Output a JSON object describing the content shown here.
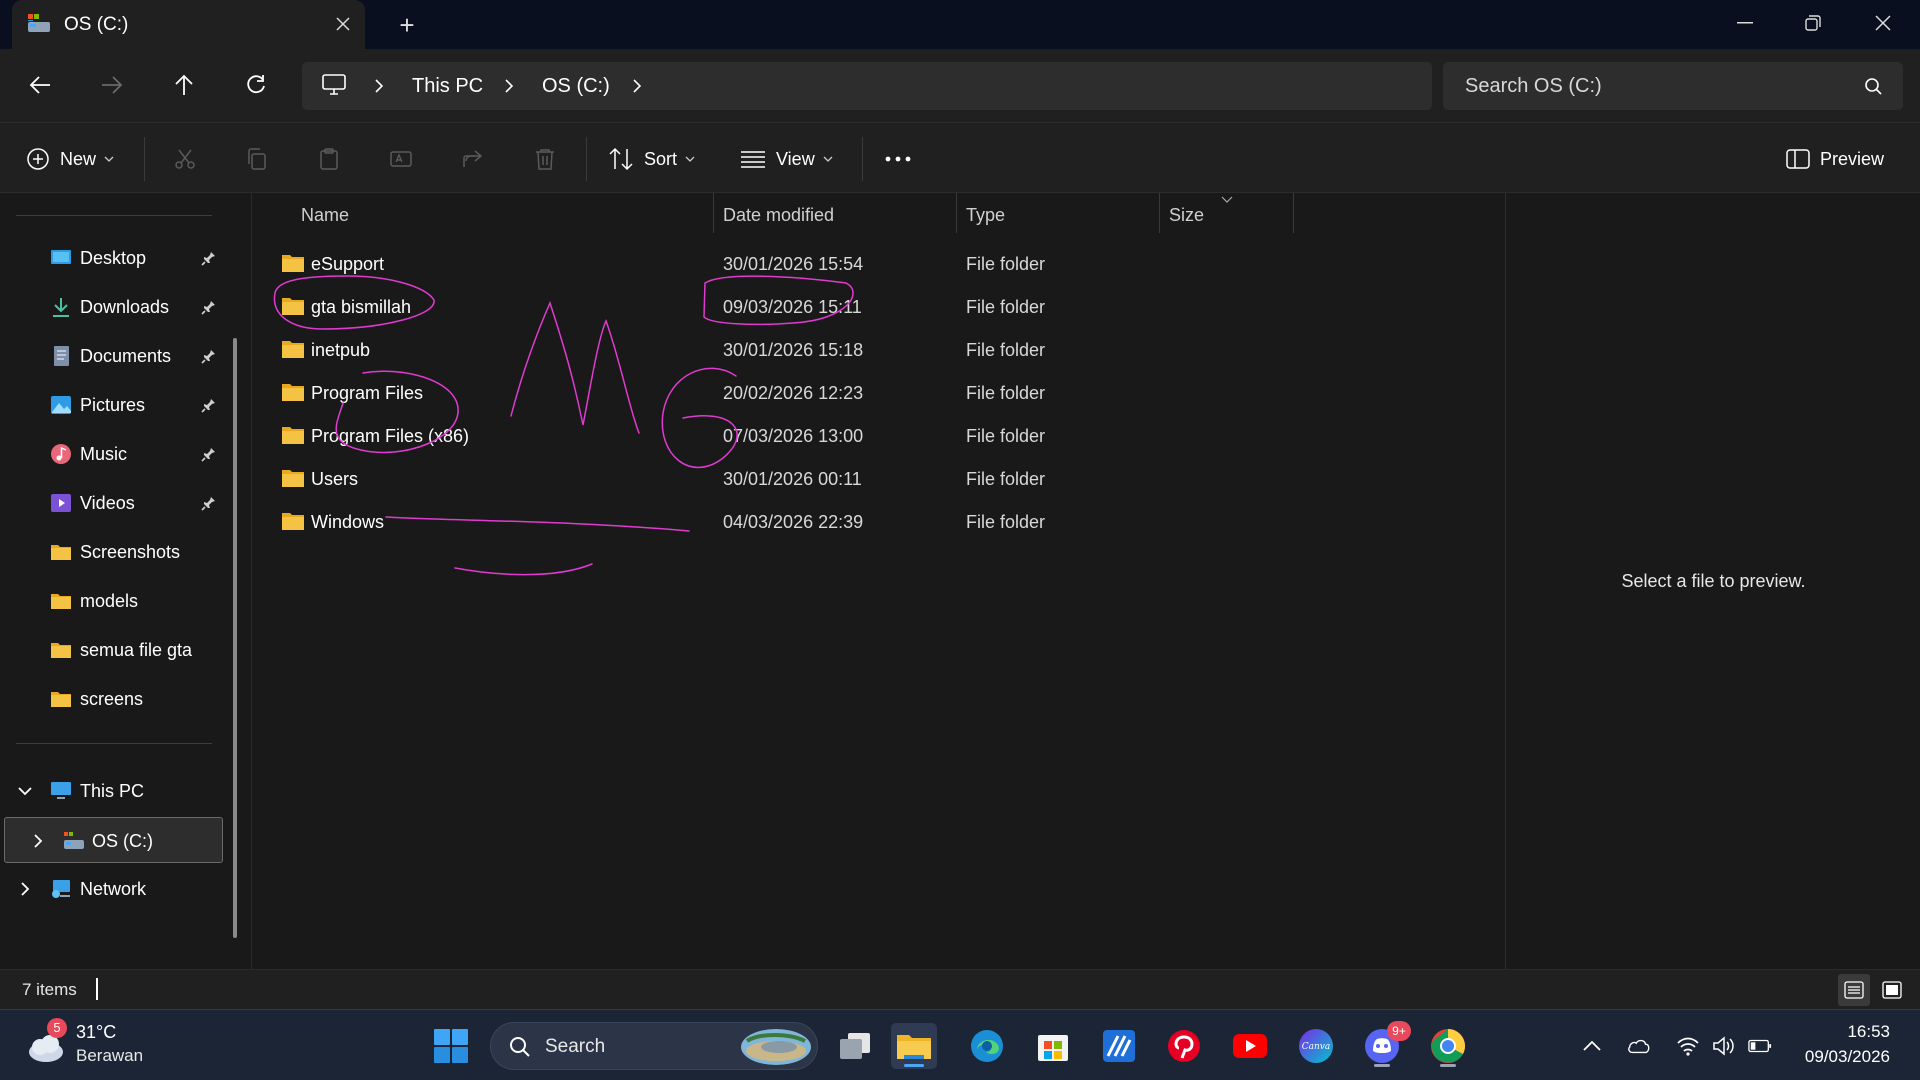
{
  "window": {
    "tab_title": "OS (C:)",
    "new_tab": "+"
  },
  "navigation": {
    "breadcrumbs": [
      "This PC",
      "OS (C:)"
    ],
    "search_placeholder": "Search OS (C:)"
  },
  "toolbar": {
    "new_label": "New",
    "sort_label": "Sort",
    "view_label": "View",
    "preview_label": "Preview"
  },
  "sidebar": {
    "quick_access": [
      {
        "label": "Desktop",
        "icon": "desktop-icon",
        "pinned": true
      },
      {
        "label": "Downloads",
        "icon": "download-icon",
        "pinned": true
      },
      {
        "label": "Documents",
        "icon": "documents-icon",
        "pinned": true
      },
      {
        "label": "Pictures",
        "icon": "pictures-icon",
        "pinned": true
      },
      {
        "label": "Music",
        "icon": "music-icon",
        "pinned": true
      },
      {
        "label": "Videos",
        "icon": "videos-icon",
        "pinned": true
      },
      {
        "label": "Screenshots",
        "icon": "folder-icon",
        "pinned": false
      },
      {
        "label": "models",
        "icon": "folder-icon",
        "pinned": false
      },
      {
        "label": "semua file gta",
        "icon": "folder-icon",
        "pinned": false
      },
      {
        "label": "screens",
        "icon": "folder-icon",
        "pinned": false
      }
    ],
    "this_pc": "This PC",
    "drive": "OS (C:)",
    "network": "Network"
  },
  "file_list": {
    "columns": [
      "Name",
      "Date modified",
      "Type",
      "Size"
    ],
    "rows": [
      {
        "name": "eSupport",
        "date": "30/01/2026 15:54",
        "type": "File folder"
      },
      {
        "name": "gta bismillah",
        "date": "09/03/2026 15:11",
        "type": "File folder"
      },
      {
        "name": "inetpub",
        "date": "30/01/2026 15:18",
        "type": "File folder"
      },
      {
        "name": "Program Files",
        "date": "20/02/2026 12:23",
        "type": "File folder"
      },
      {
        "name": "Program Files (x86)",
        "date": "07/03/2026 13:00",
        "type": "File folder"
      },
      {
        "name": "Users",
        "date": "30/01/2026 00:11",
        "type": "File folder"
      },
      {
        "name": "Windows",
        "date": "04/03/2026 22:39",
        "type": "File folder"
      }
    ]
  },
  "preview": {
    "message": "Select a file to preview."
  },
  "status": {
    "item_count": "7 items"
  },
  "taskbar": {
    "weather_temp": "31°C",
    "weather_desc": "Berawan",
    "weather_badge": "5",
    "search_label": "Search",
    "discord_badge": "9+",
    "canva_label": "Canva",
    "time": "16:53",
    "date": "09/03/2026"
  },
  "colors": {
    "accent": "#4ea5f5",
    "folder": "#f5c344",
    "annotation": "#e03ad0",
    "background": "#191919"
  }
}
